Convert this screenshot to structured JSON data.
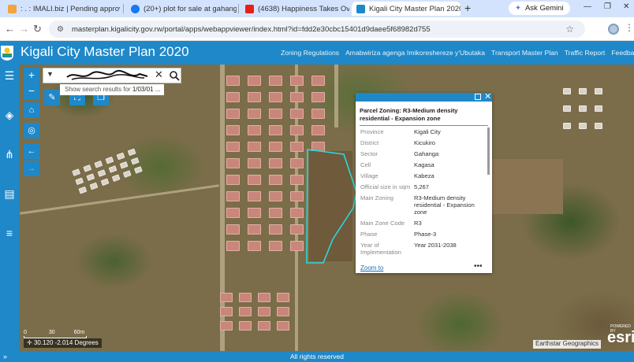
{
  "browser": {
    "tabs": [
      {
        "label": ": . : IMALI.biz | Pending approval",
        "favicon_color": "#f2a33a",
        "active": false
      },
      {
        "label": "(20+) plot for sale at gahanga",
        "favicon_color": "#1877f2",
        "active": false
      },
      {
        "label": "(4638) Happiness Takes Over",
        "favicon_color": "#e62117",
        "active": false
      },
      {
        "label": "Kigali City Master Plan 2020",
        "favicon_color": "#1e88c9",
        "active": true
      }
    ],
    "new_tab_label": "+",
    "gemini_label": "Ask Gemini",
    "url": "masterplan.kigalicity.gov.rw/portal/apps/webappviewer/index.html?id=fdd2e30cbc15401d9daee5f68982d755"
  },
  "app": {
    "title": "Kigali City Master Plan 2020",
    "links": [
      "Zoning Regulations",
      "Amabwiriza agenga Imikoreshereze y'Ubutaka",
      "Transport Master Plan",
      "Traffic Report",
      "Feedback Form"
    ],
    "accent_color": "#1e88c9"
  },
  "search": {
    "value": "",
    "suggestion_prefix": "Show search results for ",
    "suggestion_term": "1/03/01 ..."
  },
  "popup": {
    "title": "Parcel Zoning: R3-Medium density residential - Expansion zone",
    "fields": [
      {
        "key": "Province",
        "value": "Kigali City"
      },
      {
        "key": "District",
        "value": "Kicukiro"
      },
      {
        "key": "Sector",
        "value": "Gahanga"
      },
      {
        "key": "Cell",
        "value": "Kagasa"
      },
      {
        "key": "Village",
        "value": "Kabeza"
      },
      {
        "key": "Official size in sqm",
        "value": "5,267"
      },
      {
        "key": "Main Zoning",
        "value": "R3-Medium density residential - Expansion zone"
      },
      {
        "key": "Main Zone Code",
        "value": "R3"
      },
      {
        "key": "Phase",
        "value": "Phase-3"
      },
      {
        "key": "Year of Implementation",
        "value": "Year 2031-2038"
      }
    ],
    "zoom_label": "Zoom to",
    "more_label": "•••"
  },
  "map": {
    "scale_labels": [
      "0",
      "30",
      "60m"
    ],
    "coordinates": "30.120 -2.014 Degrees",
    "attribution": "Earthstar Geographics",
    "powered_by": "POWERED BY",
    "esri_label": "esri"
  },
  "footer": {
    "text": "All rights reserved",
    "expand_label": "»"
  }
}
